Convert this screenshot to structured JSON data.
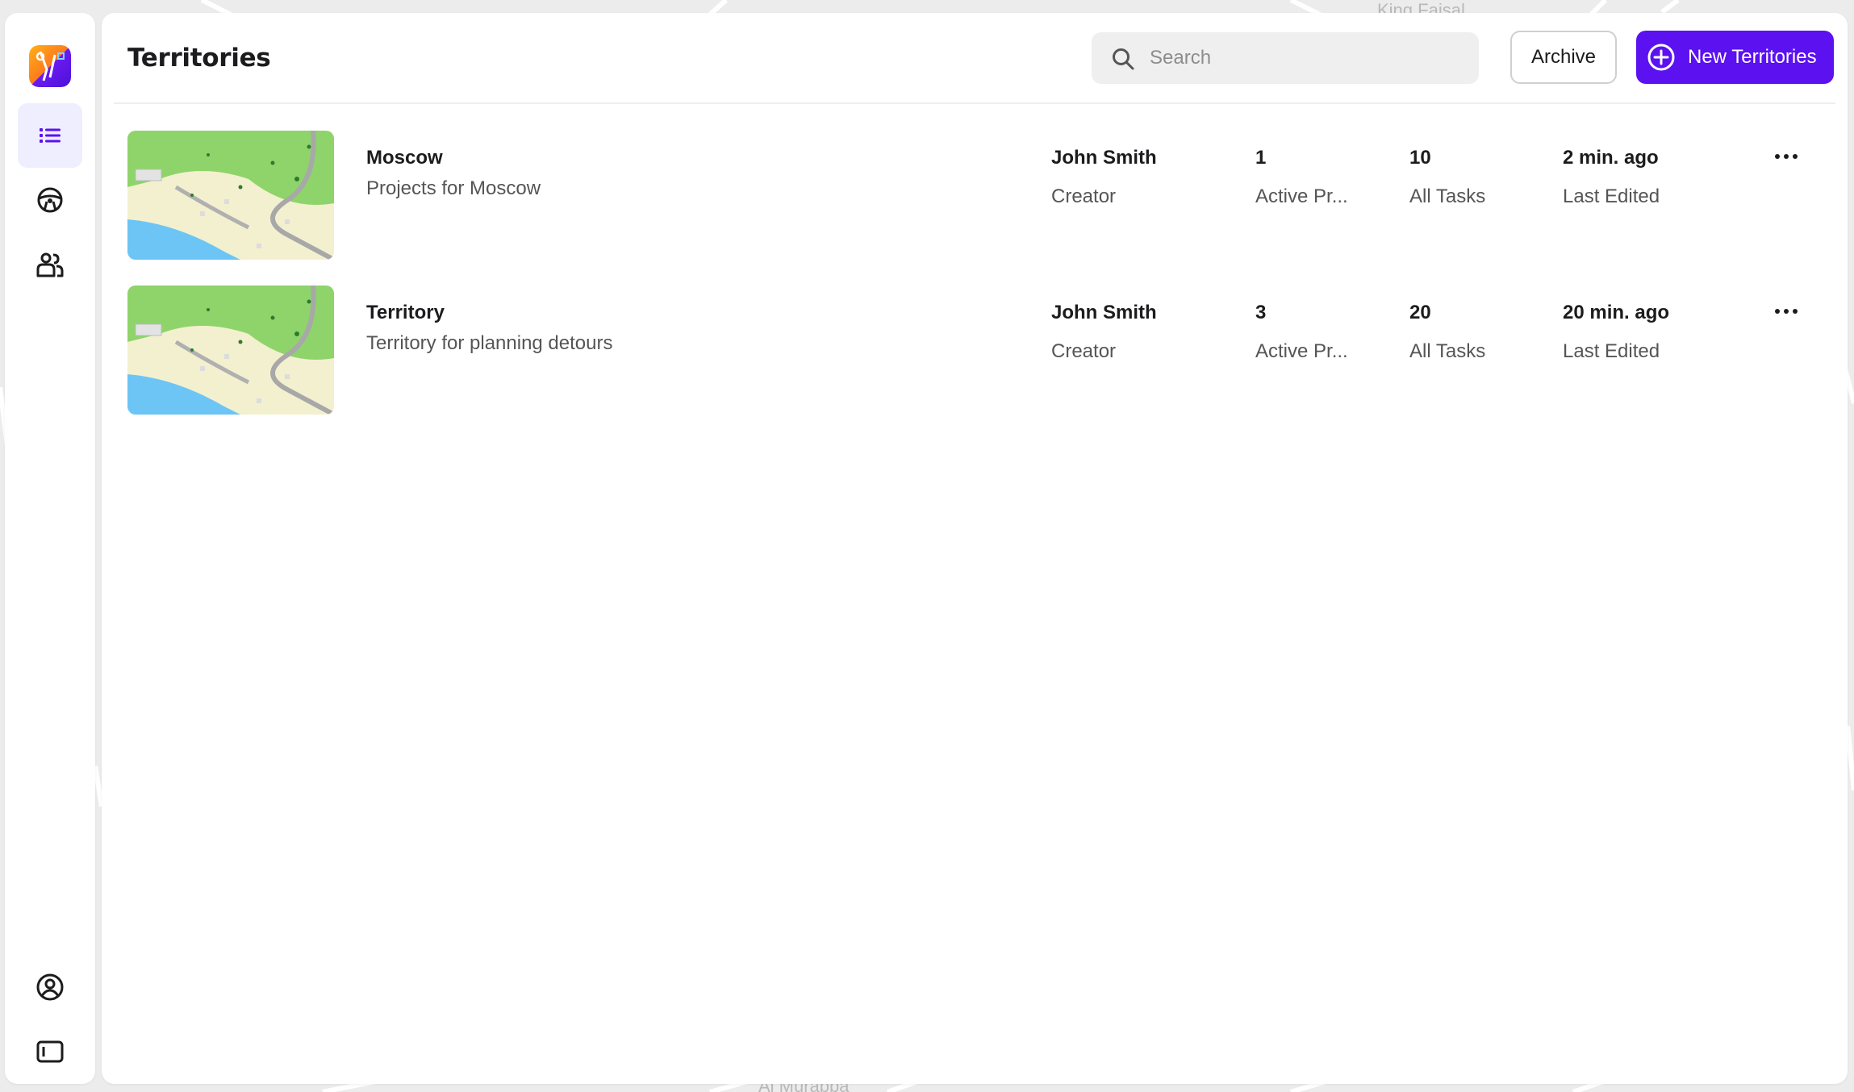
{
  "app": {
    "page_title": "Territories"
  },
  "sidebar": {
    "items": [
      {
        "name": "list",
        "icon": "list-icon",
        "active": true
      },
      {
        "name": "vehicles",
        "icon": "steering-wheel-icon",
        "active": false
      },
      {
        "name": "drivers",
        "icon": "users-icon",
        "active": false
      }
    ],
    "bottom_items": [
      {
        "name": "profile",
        "icon": "user-circle-icon"
      },
      {
        "name": "toggle-sidebar",
        "icon": "sidebar-toggle-icon"
      }
    ]
  },
  "header": {
    "search_placeholder": "Search",
    "archive_label": "Archive",
    "new_label": "New Territories"
  },
  "map_background": {
    "labels": [
      "King Faisal",
      "Al Murabba"
    ]
  },
  "territories": [
    {
      "name": "Moscow",
      "description": "Projects for Moscow",
      "creator": "John Smith",
      "creator_label": "Creator",
      "active_projects": "1",
      "active_projects_label": "Active Pr...",
      "all_tasks": "10",
      "all_tasks_label": "All Tasks",
      "last_edited": "2 min. ago",
      "last_edited_label": "Last Edited"
    },
    {
      "name": "Territory",
      "description": "Territory for planning detours",
      "creator": "John Smith",
      "creator_label": "Creator",
      "active_projects": "3",
      "active_projects_label": "Active Pr...",
      "all_tasks": "20",
      "all_tasks_label": "All Tasks",
      "last_edited": "20 min. ago",
      "last_edited_label": "Last Edited"
    }
  ],
  "colors": {
    "accent": "#5b11f0",
    "active_nav_bg": "#eeeefe",
    "map_green": "#8ed46a",
    "map_water": "#6cc5f5",
    "map_sand": "#f3f0cf"
  }
}
